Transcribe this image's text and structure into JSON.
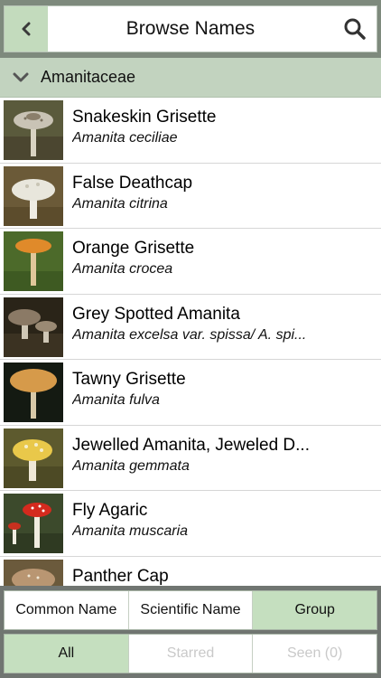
{
  "header": {
    "title": "Browse Names",
    "back_icon": "chevron-left-icon",
    "search_icon": "search-icon"
  },
  "section": {
    "label": "Amanitaceae",
    "icon": "chevron-down-icon"
  },
  "items": [
    {
      "common": "Snakeskin Grisette",
      "scientific": "Amanita ceciliae"
    },
    {
      "common": "False Deathcap",
      "scientific": "Amanita citrina"
    },
    {
      "common": "Orange Grisette",
      "scientific": "Amanita crocea"
    },
    {
      "common": "Grey Spotted Amanita",
      "scientific": "Amanita excelsa var. spissa/ A. spi..."
    },
    {
      "common": "Tawny Grisette",
      "scientific": "Amanita fulva"
    },
    {
      "common": "Jewelled Amanita, Jeweled D...",
      "scientific": "Amanita gemmata"
    },
    {
      "common": "Fly Agaric",
      "scientific": "Amanita muscaria"
    },
    {
      "common": "Panther Cap",
      "scientific": ""
    }
  ],
  "sort_tabs": {
    "common": "Common Name",
    "scientific": "Scientific Name",
    "group": "Group",
    "active": "Group"
  },
  "filter_tabs": {
    "all": "All",
    "starred": "Starred",
    "seen": "Seen (0)",
    "active": "All"
  },
  "colors": {
    "accent": "#c5dfbf",
    "section_bg": "#c2d3bf",
    "header_bg": "#7e8a7d"
  }
}
